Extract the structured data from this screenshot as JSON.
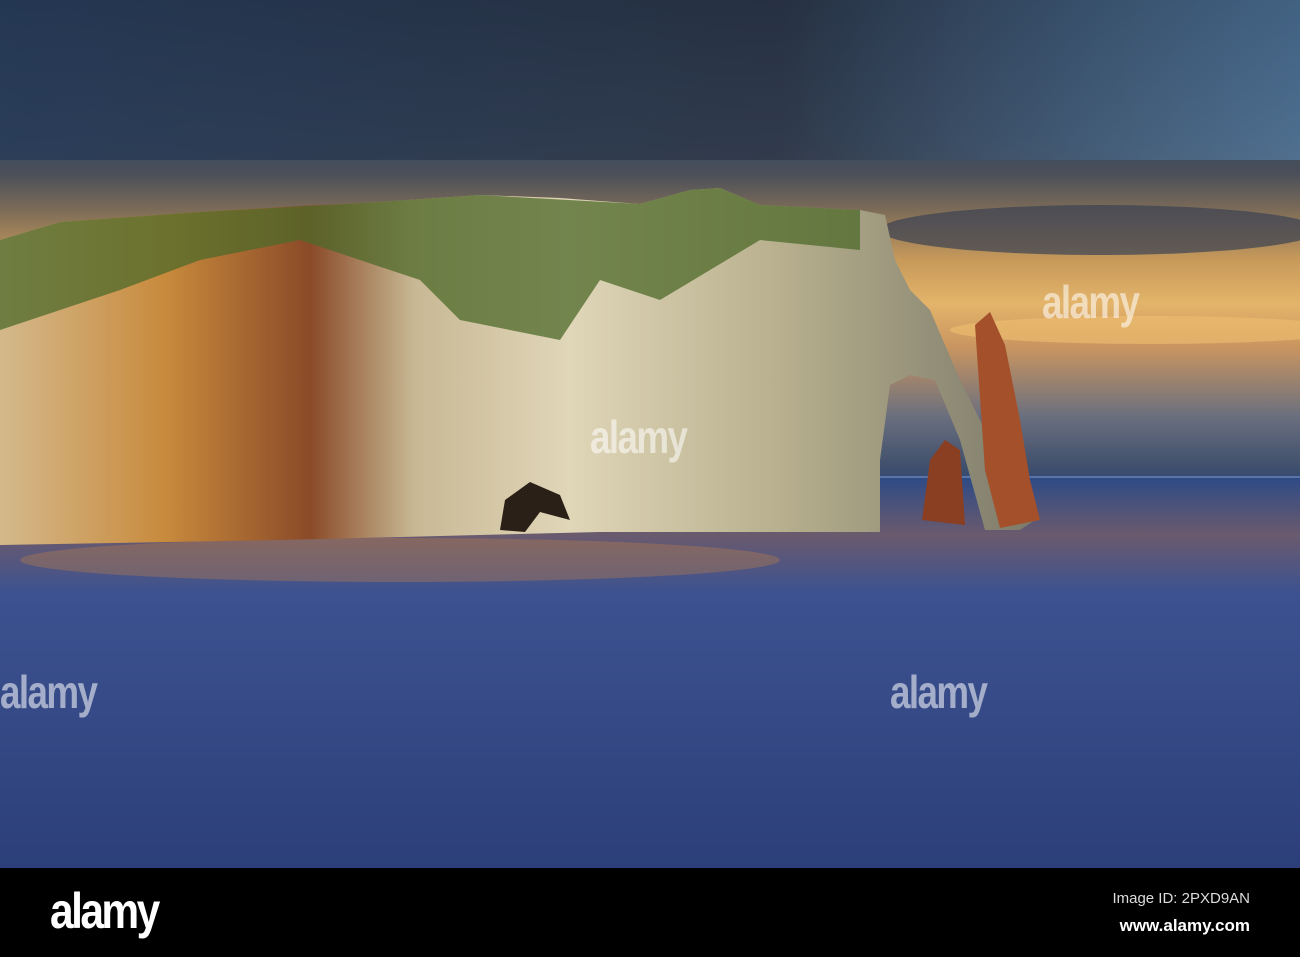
{
  "photo": {
    "subject": "chalk cliffs with arch and sea stack at sunset over calm sea",
    "watermark": "alamy",
    "colors": {
      "sky_dark": "#1c2a3c",
      "sky_gold": "#e3b46a",
      "cliff_light": "#d8c9a0",
      "cliff_orange": "#c46a2a",
      "sea": "#2f4f88"
    }
  },
  "footer": {
    "logo": "alamy",
    "image_id": "Image ID: 2PXD9AN",
    "website": "www.alamy.com"
  }
}
